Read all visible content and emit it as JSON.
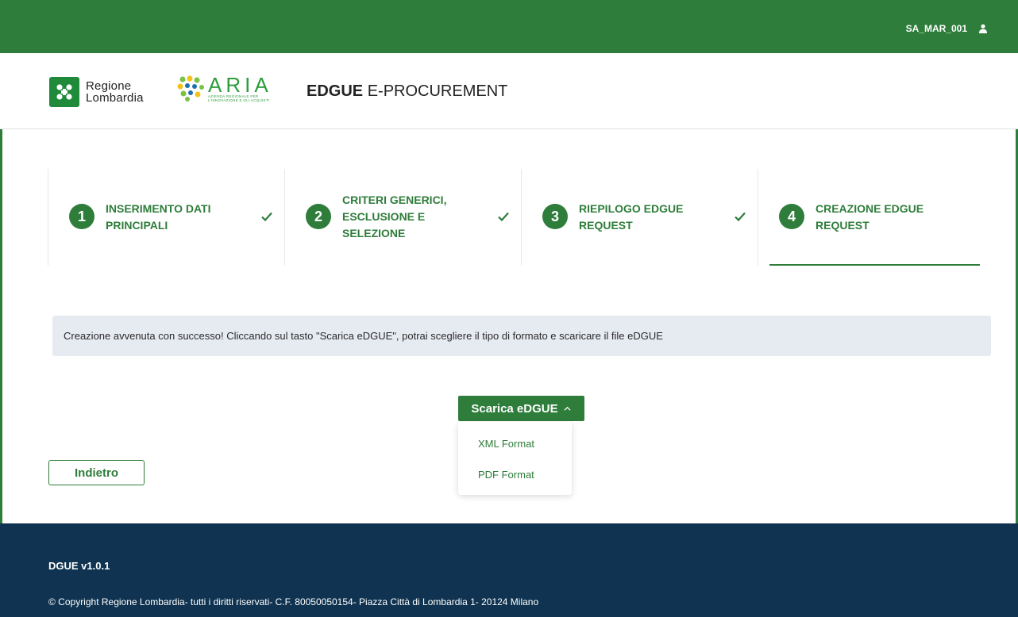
{
  "topbar": {
    "username": "SA_MAR_001",
    "user_icon": "user-icon"
  },
  "header": {
    "logo_regione_line1": "Regione",
    "logo_regione_line2": "Lombardia",
    "logo_aria_word": "ARIA",
    "logo_aria_tagline": "AZIENDA REGIONALE PER L'INNOVAZIONE E GLI ACQUISTI",
    "app_title_bold": "EDGUE",
    "app_title_rest": "E-PROCUREMENT"
  },
  "steps": [
    {
      "num": "1",
      "line1": "INSERIMENTO DATI",
      "line2": "PRINCIPALI",
      "line3": "",
      "completed": true
    },
    {
      "num": "2",
      "line1": "CRITERI GENERICI,",
      "line2": "ESCLUSIONE E",
      "line3": "SELEZIONE",
      "completed": true
    },
    {
      "num": "3",
      "line1": "RIEPILOGO EDGUE",
      "line2": "REQUEST",
      "line3": "",
      "completed": true
    },
    {
      "num": "4",
      "line1": "CREAZIONE EDGUE",
      "line2": "REQUEST",
      "line3": "",
      "completed": false
    }
  ],
  "alert": {
    "text": "Creazione avvenuta con successo! Cliccando sul tasto \"Scarica eDGUE\", potrai scegliere il tipo di formato e scaricare il file eDGUE"
  },
  "download": {
    "label": "Scarica eDGUE",
    "options": [
      "XML Format",
      "PDF Format"
    ]
  },
  "back_label": "Indietro",
  "footer": {
    "version": "DGUE v1.0.1",
    "copyright": "© Copyright Regione Lombardia- tutti i diritti riservati- C.F. 80050050154- Piazza Città di Lombardia 1- 20124 Milano"
  },
  "colors": {
    "brand_green": "#2e7d3a",
    "footer_navy": "#0f3350",
    "alert_bg": "#e6eaf1"
  }
}
